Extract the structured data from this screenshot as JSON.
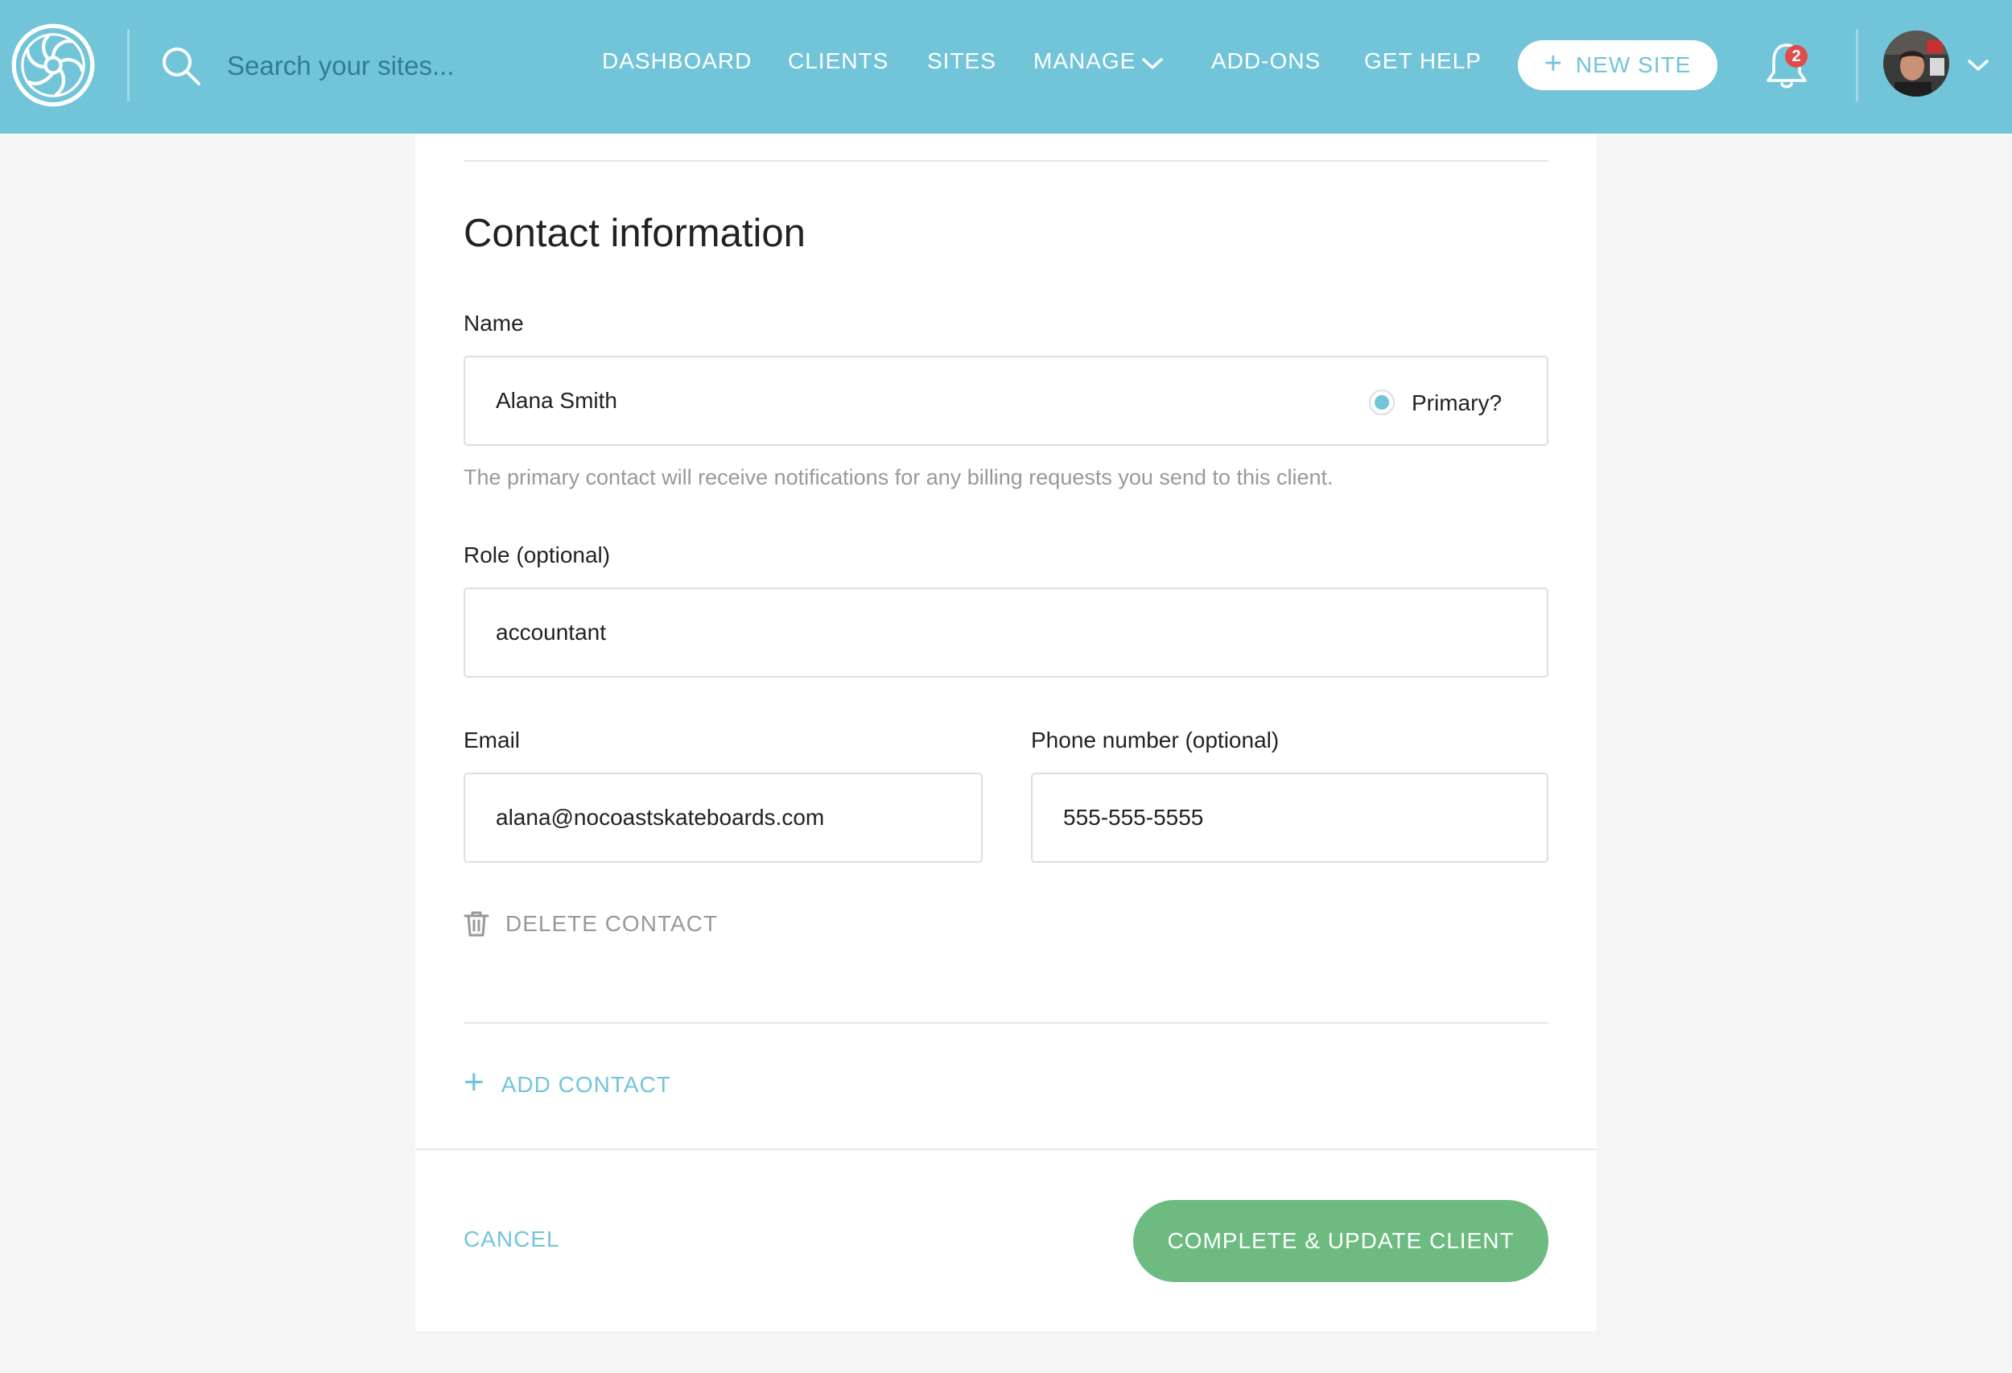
{
  "colors": {
    "brand": "#72c5d9",
    "success": "#6dbb81",
    "badge": "#e04c4c",
    "muted_text": "#999999",
    "page_background": "#f5f5f5"
  },
  "header": {
    "logo_icon": "flywheel-logo-icon",
    "search": {
      "icon": "search-icon",
      "placeholder": "Search your sites..."
    },
    "nav": {
      "dashboard": "DASHBOARD",
      "clients": "CLIENTS",
      "sites": "SITES",
      "manage": "MANAGE",
      "addons": "ADD-ONS",
      "get_help": "GET HELP"
    },
    "new_site": {
      "icon": "plus-icon",
      "label": "NEW SITE"
    },
    "notifications": {
      "icon": "bell-icon",
      "count": "2"
    },
    "user_menu": {
      "icon": "chevron-down-icon"
    }
  },
  "form": {
    "title": "Contact information",
    "name_label": "Name",
    "name_value": "Alana Smith",
    "primary_label": "Primary?",
    "primary_selected": true,
    "primary_help": "The primary contact will receive notifications for any billing requests you send to this client.",
    "role_label": "Role (optional)",
    "role_value": "accountant",
    "email_label": "Email",
    "email_value": "alana@nocoastskateboards.com",
    "phone_label": "Phone number (optional)",
    "phone_value": "555-555-5555",
    "delete_label": "DELETE CONTACT",
    "add_label": "ADD CONTACT"
  },
  "footer": {
    "cancel_label": "CANCEL",
    "complete_label": "COMPLETE & UPDATE CLIENT"
  }
}
